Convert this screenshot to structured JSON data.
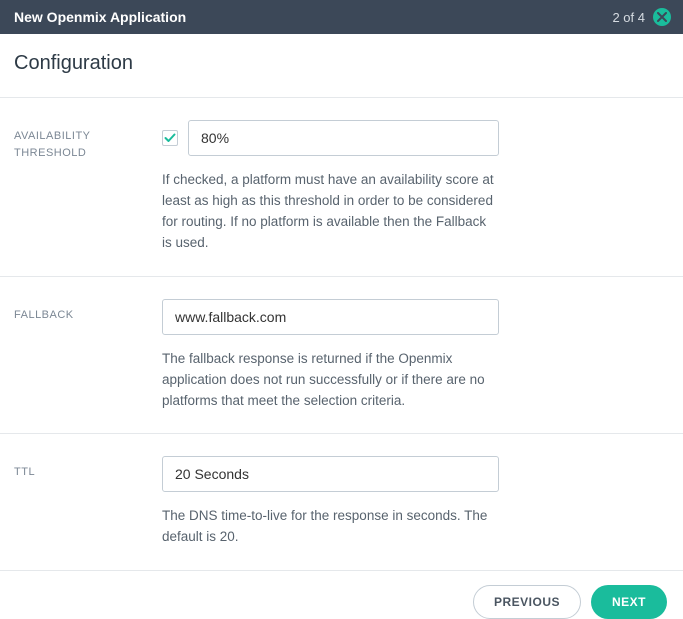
{
  "header": {
    "title": "New Openmix Application",
    "step": "2 of 4"
  },
  "section_title": "Configuration",
  "availability": {
    "label": "AVAILABILITY THRESHOLD",
    "value": "80%",
    "help": "If checked, a platform must have an availability score at least as high as this threshold in order to be considered for routing. If no platform is available then the Fallback is used."
  },
  "fallback": {
    "label": "FALLBACK",
    "value": "www.fallback.com",
    "help": "The fallback response is returned if the Openmix application does not run successfully or if there are no platforms that meet the selection criteria."
  },
  "ttl": {
    "label": "TTL",
    "value": "20 Seconds",
    "help": "The DNS time-to-live for the response in seconds. The default is 20."
  },
  "buttons": {
    "previous": "PREVIOUS",
    "next": "NEXT"
  }
}
